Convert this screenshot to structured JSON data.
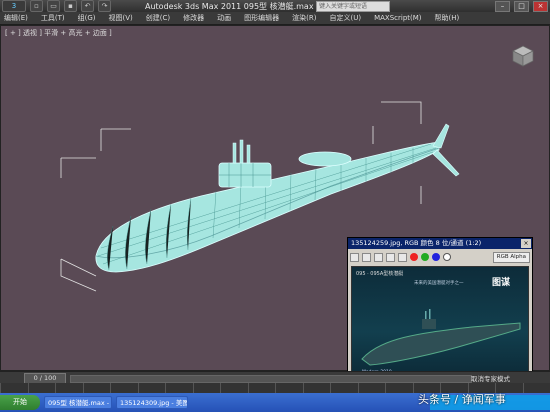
{
  "window": {
    "title": "Autodesk 3ds Max  2011      095型 核潜艇.max",
    "search_placeholder": "键入关键字或短语"
  },
  "menu": [
    "编辑(E)",
    "工具(T)",
    "组(G)",
    "视图(V)",
    "创建(C)",
    "修改器",
    "动画",
    "图形编辑器",
    "渲染(R)",
    "自定义(U)",
    "MAXScript(M)",
    "帮助(H)"
  ],
  "viewport": {
    "label": "[ + ] 透视 ] 平滑 + 高光 + 边面 ]",
    "background": "#5a4a55",
    "model_color": "#a6e6e0"
  },
  "render_window": {
    "title": "135124259.jpg, RGB 颜色 8 位/通道 (1:2)",
    "close_icon": "×",
    "alpha_label": "RGB Alpha",
    "image_title": "095 · 095A型核潜艇",
    "image_subtitle": "未来的美国潜艇对手之一",
    "image_logo": "图谋",
    "image_mark": "Modern 2010"
  },
  "status": {
    "frame_counter": "0 / 100",
    "mode_text": "取消专家模式"
  },
  "taskbar": {
    "start_label": "开始",
    "items": [
      "095型 核潜艇.max - A...",
      "135124309.jpg - 美图..."
    ]
  },
  "watermark": "头条号 / 诤闻军事"
}
